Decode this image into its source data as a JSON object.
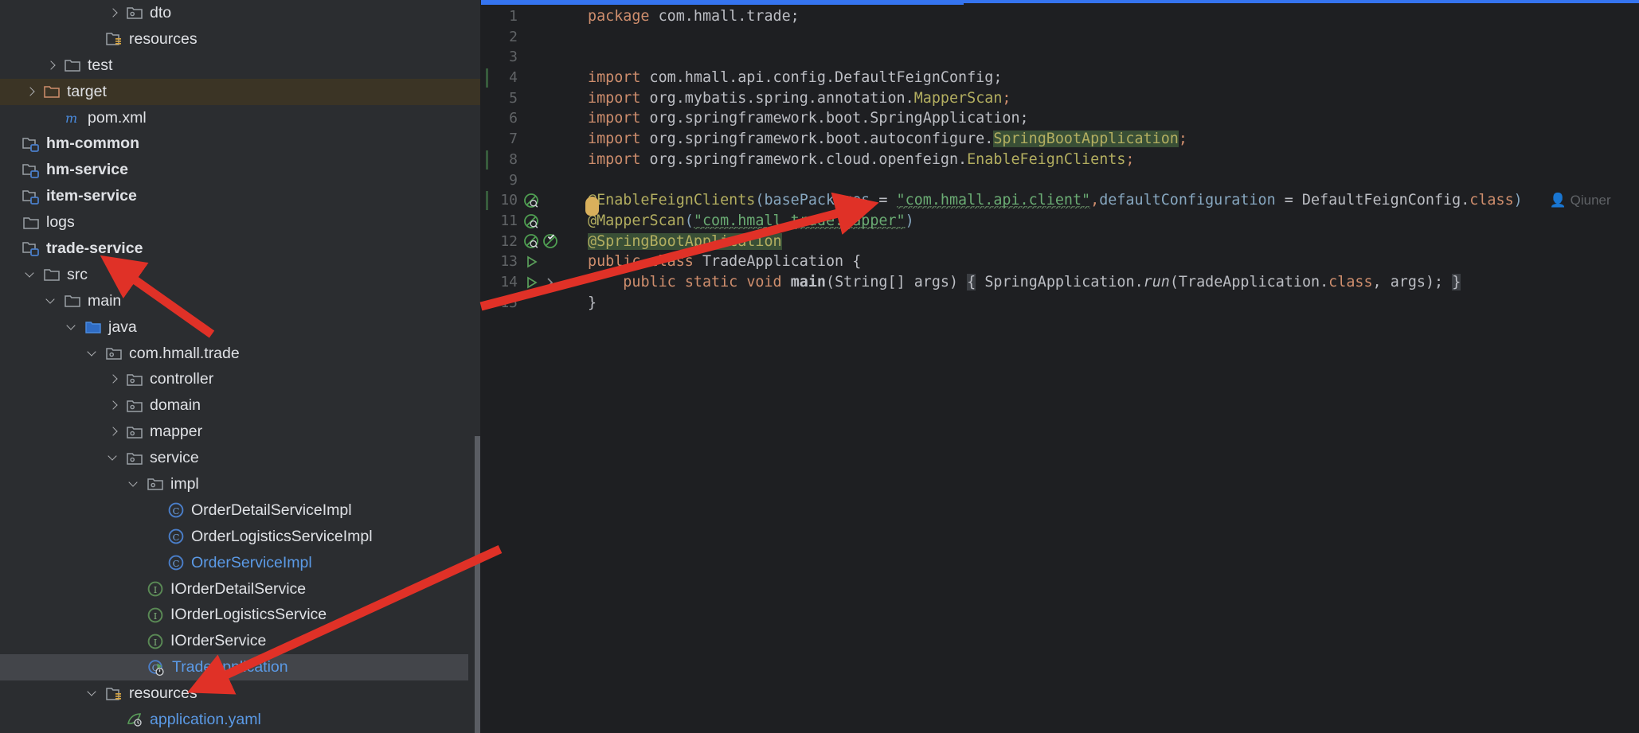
{
  "app": {
    "kind": "ide-project-view",
    "theme": "dark"
  },
  "colors": {
    "panel_bg": "#2b2d30",
    "editor_bg": "#1e1f22",
    "selected_row": "#43454a",
    "target_row": "#3b3425",
    "accent_blue": "#3574f0",
    "text": "#dfe1e5",
    "blue_text": "#5b9ae6",
    "keyword": "#cf8e6d",
    "annotation": "#b3ae60",
    "string": "#6aab73",
    "param": "#87a7c0",
    "line_number": "#606366",
    "arrow_red": "#e03127",
    "highlight_green": "#394f36",
    "caret_marker": "#d9b05c"
  },
  "project_tree": {
    "items": [
      {
        "label": "dto",
        "indent": 5,
        "arrow": "right",
        "icon": "package-folder-icon",
        "style": "normal"
      },
      {
        "label": "resources",
        "indent": 4,
        "arrow": "none",
        "icon": "resources-folder-icon",
        "style": "normal"
      },
      {
        "label": "test",
        "indent": 2,
        "arrow": "right",
        "icon": "folder-icon",
        "style": "normal"
      },
      {
        "label": "target",
        "indent": 1,
        "arrow": "right",
        "icon": "excluded-folder-icon",
        "style": "normal",
        "row_highlight": "target"
      },
      {
        "label": "pom.xml",
        "indent": 2,
        "arrow": "none",
        "icon": "maven-file-icon",
        "style": "normal"
      },
      {
        "label": "hm-common",
        "indent": 0,
        "arrow": "none",
        "icon": "module-icon",
        "style": "bold"
      },
      {
        "label": "hm-service",
        "indent": 0,
        "arrow": "none",
        "icon": "module-icon",
        "style": "bold"
      },
      {
        "label": "item-service",
        "indent": 0,
        "arrow": "none",
        "icon": "module-icon",
        "style": "bold"
      },
      {
        "label": "logs",
        "indent": 0,
        "arrow": "none",
        "icon": "folder-icon",
        "style": "normal"
      },
      {
        "label": "trade-service",
        "indent": 0,
        "arrow": "none",
        "icon": "module-icon",
        "style": "bold"
      },
      {
        "label": "src",
        "indent": 1,
        "arrow": "down",
        "icon": "folder-icon",
        "style": "normal"
      },
      {
        "label": "main",
        "indent": 2,
        "arrow": "down",
        "icon": "folder-icon",
        "style": "normal"
      },
      {
        "label": "java",
        "indent": 3,
        "arrow": "down",
        "icon": "sources-folder-icon",
        "style": "normal"
      },
      {
        "label": "com.hmall.trade",
        "indent": 4,
        "arrow": "down",
        "icon": "package-folder-icon",
        "style": "normal"
      },
      {
        "label": "controller",
        "indent": 5,
        "arrow": "right",
        "icon": "package-folder-icon",
        "style": "normal"
      },
      {
        "label": "domain",
        "indent": 5,
        "arrow": "right",
        "icon": "package-folder-icon",
        "style": "normal"
      },
      {
        "label": "mapper",
        "indent": 5,
        "arrow": "right",
        "icon": "package-folder-icon",
        "style": "normal"
      },
      {
        "label": "service",
        "indent": 5,
        "arrow": "down",
        "icon": "package-folder-icon",
        "style": "normal"
      },
      {
        "label": "impl",
        "indent": 6,
        "arrow": "down",
        "icon": "package-folder-icon",
        "style": "normal"
      },
      {
        "label": "OrderDetailServiceImpl",
        "indent": 7,
        "arrow": "none",
        "icon": "java-class-icon",
        "style": "normal"
      },
      {
        "label": "OrderLogisticsServiceImpl",
        "indent": 7,
        "arrow": "none",
        "icon": "java-class-icon",
        "style": "normal"
      },
      {
        "label": "OrderServiceImpl",
        "indent": 7,
        "arrow": "none",
        "icon": "java-class-icon",
        "style": "blue"
      },
      {
        "label": "IOrderDetailService",
        "indent": 6,
        "arrow": "none",
        "icon": "java-interface-icon",
        "style": "normal"
      },
      {
        "label": "IOrderLogisticsService",
        "indent": 6,
        "arrow": "none",
        "icon": "java-interface-icon",
        "style": "normal"
      },
      {
        "label": "IOrderService",
        "indent": 6,
        "arrow": "none",
        "icon": "java-interface-icon",
        "style": "normal"
      },
      {
        "label": "TradeApplication",
        "indent": 6,
        "arrow": "none",
        "icon": "java-runnable-class-icon",
        "style": "blue",
        "row_highlight": "selected"
      },
      {
        "label": "resources",
        "indent": 4,
        "arrow": "down",
        "icon": "resources-folder-icon",
        "style": "normal"
      },
      {
        "label": "application.yaml",
        "indent": 5,
        "arrow": "none",
        "icon": "yaml-file-icon",
        "style": "blue"
      }
    ]
  },
  "editor": {
    "file": "TradeApplication.java",
    "inlay_author": "Qiuner",
    "lines": [
      {
        "n": "1",
        "gutter": [],
        "changed": false
      },
      {
        "n": "2",
        "gutter": [],
        "changed": false
      },
      {
        "n": "3",
        "gutter": [],
        "changed": false
      },
      {
        "n": "4",
        "gutter": [],
        "changed": true
      },
      {
        "n": "5",
        "gutter": [],
        "changed": false
      },
      {
        "n": "6",
        "gutter": [],
        "changed": false
      },
      {
        "n": "7",
        "gutter": [],
        "changed": false
      },
      {
        "n": "8",
        "gutter": [],
        "changed": true
      },
      {
        "n": "9",
        "gutter": [],
        "changed": false
      },
      {
        "n": "10",
        "gutter": [
          "spring-bean-icon"
        ],
        "changed": true
      },
      {
        "n": "11",
        "gutter": [
          "spring-bean-icon"
        ],
        "changed": false
      },
      {
        "n": "12",
        "gutter": [
          "spring-bean-icon",
          "spring-config-icon"
        ],
        "changed": false
      },
      {
        "n": "13",
        "gutter": [
          "run-icon"
        ],
        "changed": false
      },
      {
        "n": "14",
        "gutter": [
          "run-icon",
          "fold-icon"
        ],
        "changed": false
      },
      {
        "n": "15",
        "gutter": [],
        "changed": false
      }
    ],
    "source_text": [
      "package com.hmall.trade;",
      "",
      "",
      "import com.hmall.api.config.DefaultFeignConfig;",
      "import org.mybatis.spring.annotation.MapperScan;",
      "import org.springframework.boot.SpringApplication;",
      "import org.springframework.boot.autoconfigure.SpringBootApplication;",
      "import org.springframework.cloud.openfeign.EnableFeignClients;",
      "",
      "@EnableFeignClients(basePackages = \"com.hmall.api.client\",defaultConfiguration = DefaultFeignConfig.class)",
      "@MapperScan(\"com.hmall.trade.mapper\")",
      "@SpringBootApplication",
      "public class TradeApplication {",
      "    public static void main(String[] args) { SpringApplication.run(TradeApplication.class, args); }",
      "}"
    ],
    "tokens": {
      "l1": {
        "kw": "package",
        "rest": " com.hmall.trade;"
      },
      "l4": {
        "kw": "import",
        "rest": " com.hmall.api.config.DefaultFeignConfig;"
      },
      "l5": {
        "kw": "import",
        "pkg": " org.mybatis.spring.annotation.",
        "type": "MapperScan",
        "semi": ";"
      },
      "l6": {
        "kw": "import",
        "rest": " org.springframework.boot.SpringApplication;"
      },
      "l7": {
        "kw": "import",
        "pkg": " org.springframework.boot.autoconfigure.",
        "type": "SpringBootApplication",
        "semi": ";"
      },
      "l8": {
        "kw": "import",
        "pkg": " org.springframework.cloud.openfeign.",
        "type": "EnableFeignClients",
        "semi": ";"
      },
      "l10": {
        "anno": "@EnableFeignClients",
        "open": "(",
        "p1": "basePackages",
        "eq": " = ",
        "s1": "\"com.hmall.api.client\"",
        "comma": ",",
        "p2": "defaultConfiguration",
        "eq2": " = ",
        "cls": "DefaultFeignConfig",
        "dot": ".",
        "clskw": "class",
        "close": ")"
      },
      "l11": {
        "anno": "@MapperScan",
        "open": "(",
        "s1": "\"com.hmall.trade.mapper\"",
        "close": ")"
      },
      "l12": {
        "anno": "@SpringBootApplication"
      },
      "l13": {
        "kw1": "public",
        "kw2": "class",
        "name": " TradeApplication ",
        "brace": "{"
      },
      "l14": {
        "kw1": "public",
        "kw2": "static",
        "kw3": "void",
        "name": "main",
        "sig": "(String[] args)",
        "brace_open": "{",
        "cls": "SpringApplication",
        "dot": ".",
        "method": "run",
        "args": "(TradeApplication.",
        "clskw": "class",
        "tail": ", args);",
        "brace_close": "}"
      },
      "l15": {
        "brace": "}"
      }
    }
  },
  "annotations": {
    "arrows": [
      {
        "name": "arrow-to-trade-service",
        "points_to": "trade-service"
      },
      {
        "name": "arrow-to-mapperscan",
        "points_to": "@MapperScan line 11"
      },
      {
        "name": "arrow-to-tradeapplication",
        "points_to": "TradeApplication tree node"
      }
    ]
  }
}
